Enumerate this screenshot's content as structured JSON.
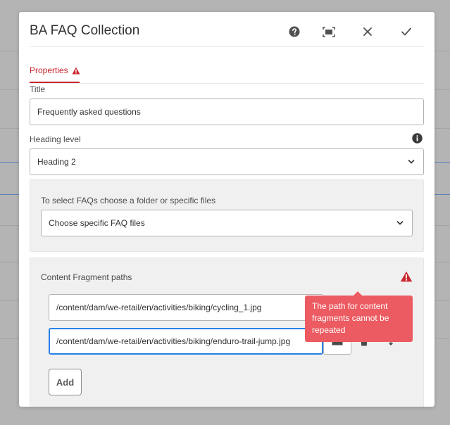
{
  "dialog": {
    "title": "BA FAQ Collection",
    "header_icons": [
      "help-icon",
      "fullscreen-icon",
      "close-icon",
      "checkmark-icon"
    ]
  },
  "tabs": [
    {
      "label": "Properties",
      "status_icon": "alert-icon",
      "active": true
    }
  ],
  "form": {
    "title_label": "Title",
    "title_value": "Frequently asked questions",
    "heading_label": "Heading level",
    "heading_value": "Heading 2",
    "heading_info_icon": "info-icon",
    "faq_source_label": "To select FAQs choose a folder or specific files",
    "faq_source_value": "Choose specific FAQ files",
    "paths_label": "Content Fragment paths",
    "paths_error_icon": "alert-icon",
    "paths": [
      {
        "value": "/content/dam/we-retail/en/activities/biking/cycling_1.jpg"
      },
      {
        "value": "/content/dam/we-retail/en/activities/biking/enduro-trail-jump.jpg"
      }
    ],
    "error_message": "The path for content fragments cannot be repeated",
    "add_label": "Add"
  },
  "colors": {
    "accent_error": "#c9252d",
    "tooltip_bg": "#ec5b62",
    "focus_blue": "#2680eb",
    "overlay": "#b4b4b4"
  }
}
